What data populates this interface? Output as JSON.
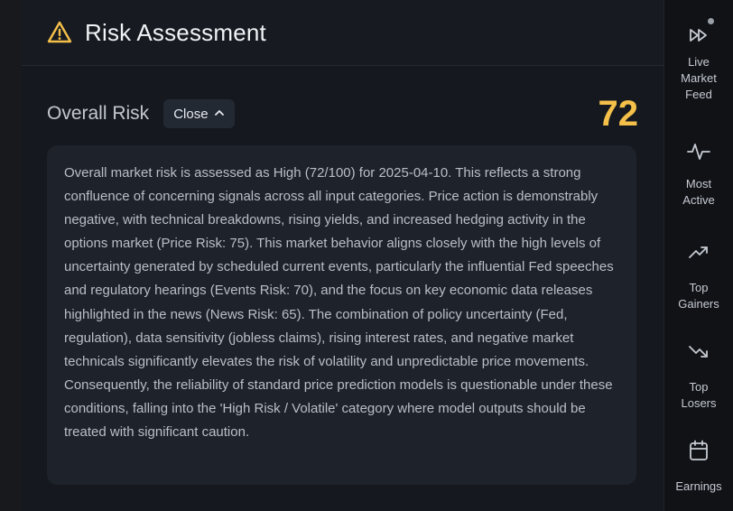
{
  "panel": {
    "title": "Risk Assessment",
    "icon": "warning-triangle-icon",
    "accent_color": "#f5c04a"
  },
  "overall_risk": {
    "label": "Overall Risk",
    "toggle_label": "Close",
    "score": "72",
    "summary": "Overall market risk is assessed as High (72/100) for 2025-04-10. This reflects a strong confluence of concerning signals across all input categories. Price action is demonstrably negative, with technical breakdowns, rising yields, and increased hedging activity in the options market (Price Risk: 75). This market behavior aligns closely with the high levels of uncertainty generated by scheduled current events, particularly the influential Fed speeches and regulatory hearings (Events Risk: 70), and the focus on key economic data releases highlighted in the news (News Risk: 65). The combination of policy uncertainty (Fed, regulation), data sensitivity (jobless claims), rising interest rates, and negative market technicals significantly elevates the risk of volatility and unpredictable price movements. Consequently, the reliability of standard price prediction models is questionable under these conditions, falling into the 'High Risk / Volatile' category where model outputs should be treated with significant caution."
  },
  "sidebar": {
    "items": [
      {
        "label": "Live\nMarket\nFeed",
        "icon": "fast-forward-icon"
      },
      {
        "label": "Most\nActive",
        "icon": "activity-pulse-icon"
      },
      {
        "label": "Top\nGainers",
        "icon": "trending-up-icon"
      },
      {
        "label": "Top\nLosers",
        "icon": "trending-down-icon"
      },
      {
        "label": "Earnings",
        "icon": "calendar-icon"
      }
    ]
  }
}
